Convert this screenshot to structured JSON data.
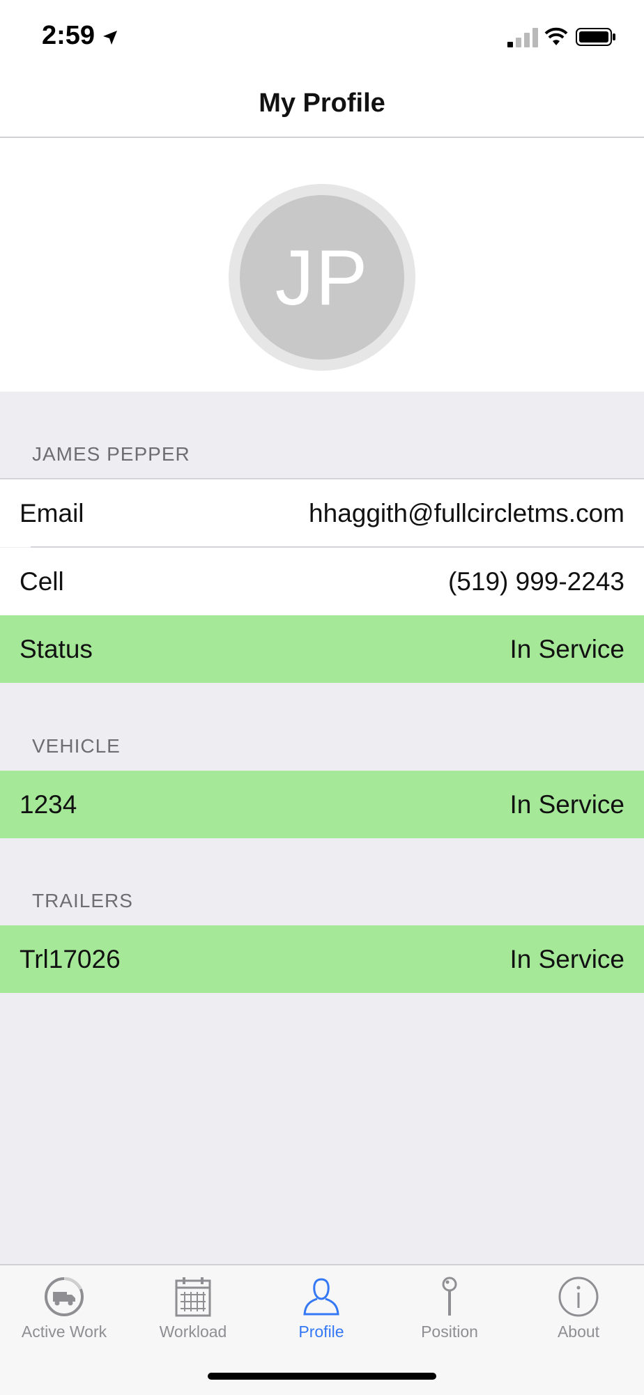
{
  "status_bar": {
    "time": "2:59",
    "icons": [
      "location-arrow-icon",
      "cellular-signal-icon",
      "wifi-icon",
      "battery-icon"
    ]
  },
  "nav": {
    "title": "My Profile"
  },
  "avatar": {
    "initials": "JP"
  },
  "profile": {
    "section_title": "JAMES PEPPER",
    "email_label": "Email",
    "email_value": "hhaggith@fullcircletms.com",
    "cell_label": "Cell",
    "cell_value": "(519) 999-2243",
    "status_label": "Status",
    "status_value": "In Service"
  },
  "vehicle": {
    "section_title": "VEHICLE",
    "id": "1234",
    "status": "In Service"
  },
  "trailers": {
    "section_title": "TRAILERS",
    "id": "Trl17026",
    "status": "In Service"
  },
  "tabs": [
    {
      "label": "Active Work",
      "icon": "truck-clock-icon"
    },
    {
      "label": "Workload",
      "icon": "calendar-icon"
    },
    {
      "label": "Profile",
      "icon": "person-icon"
    },
    {
      "label": "Position",
      "icon": "pin-icon"
    },
    {
      "label": "About",
      "icon": "info-icon"
    }
  ],
  "colors": {
    "in_service": "#a5e898",
    "active_tab": "#3478f6",
    "inactive_tab": "#8e8e93"
  }
}
